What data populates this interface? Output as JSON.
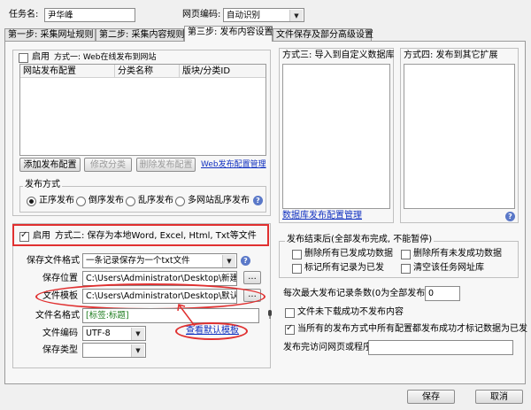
{
  "header": {
    "task_name_label": "任务名:",
    "task_name_value": "尹华峰",
    "encoding_label": "网页编码:",
    "encoding_value": "自动识别"
  },
  "tabs": [
    {
      "label": "第一步: 采集网址规则"
    },
    {
      "label": "第二步: 采集内容规则"
    },
    {
      "label": "第三步: 发布内容设置"
    },
    {
      "label": "文件保存及部分高级设置"
    }
  ],
  "method1": {
    "enable_label": "启用",
    "title": "方式一: Web在线发布到网站",
    "columns": [
      "网站发布配置",
      "分类名称",
      "版块/分类ID"
    ],
    "add_button": "添加发布配置",
    "edit_button": "修改分类",
    "delete_button": "删除发布配置",
    "manage_link": "Web发布配置管理",
    "publish_mode_label": "发布方式",
    "modes": [
      "正序发布",
      "倒序发布",
      "乱序发布",
      "多网站乱序发布"
    ]
  },
  "method2": {
    "enable_label": "启用",
    "title": "方式二: 保存为本地Word, Excel, Html, Txt等文件",
    "format_label": "保存文件格式",
    "format_value": "一条记录保存为一个txt文件",
    "location_label": "保存位置",
    "location_value": "C:\\Users\\Administrator\\Desktop\\新建文件",
    "template_label": "文件模板",
    "template_value": "C:\\Users\\Administrator\\Desktop\\默认txt",
    "filename_label": "文件名格式",
    "filename_value": "[标签:标题]",
    "encoding_label": "文件编码",
    "encoding_value": "UTF-8",
    "save_type_label": "保存类型",
    "save_type_value": "",
    "browse_label": "...",
    "view_template_link": "查看默认模板"
  },
  "method3": {
    "title": "方式三: 导入到自定义数据库",
    "link": "数据库发布配置管理"
  },
  "method4": {
    "title": "方式四: 发布到其它扩展"
  },
  "after_publish": {
    "title": "发布结束后(全部发布完成, 不能暂停)",
    "options": [
      "删除所有已发成功数据",
      "删除所有未发成功数据",
      "标记所有记录为已发",
      "清空该任务网址库"
    ]
  },
  "max_publish_label": "每次最大发布记录条数(0为全部发布):",
  "max_publish_value": "0",
  "no_publish_on_fail_label": "文件未下载成功不发布内容",
  "mark_published_label": "当所有的发布方式中所有配置都发布成功才标记数据为已发",
  "after_program_label": "发布完访问网页或程序",
  "after_program_value": "",
  "footer": {
    "save_button": "保存",
    "cancel_button": "取消"
  }
}
